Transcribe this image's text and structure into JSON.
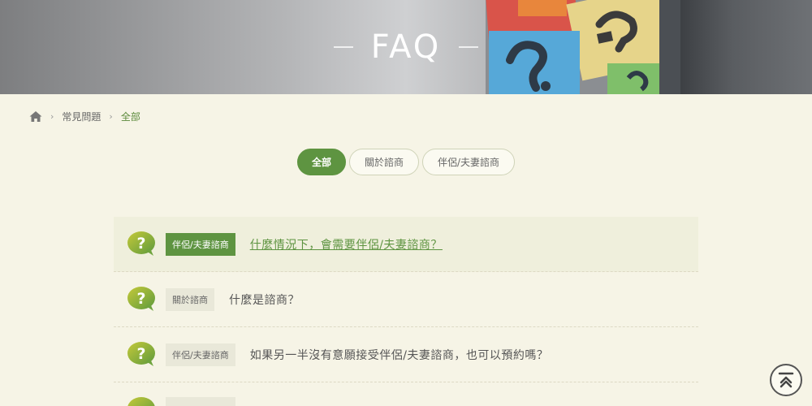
{
  "banner": {
    "title": "FAQ"
  },
  "breadcrumb": {
    "home_icon": "home-icon",
    "items": [
      "常見問題",
      "全部"
    ]
  },
  "tabs": [
    {
      "label": "全部",
      "active": true
    },
    {
      "label": "關於諮商",
      "active": false
    },
    {
      "label": "伴侶/夫妻諮商",
      "active": false
    }
  ],
  "faq": {
    "items": [
      {
        "tag": "伴侶/夫妻諮商",
        "question": "什麼情況下，會需要伴侶/夫妻諮商？",
        "active": true
      },
      {
        "tag": "關於諮商",
        "question": "什麼是諮商？",
        "active": false
      },
      {
        "tag": "伴侶/夫妻諮商",
        "question": "如果另一半沒有意願接受伴侶/夫妻諮商，也可以預約嗎？",
        "active": false
      }
    ]
  },
  "colors": {
    "accent": "#5e9441",
    "background": "#f6f4e6"
  },
  "back_to_top_icon": "arrow-up-circle-icon"
}
